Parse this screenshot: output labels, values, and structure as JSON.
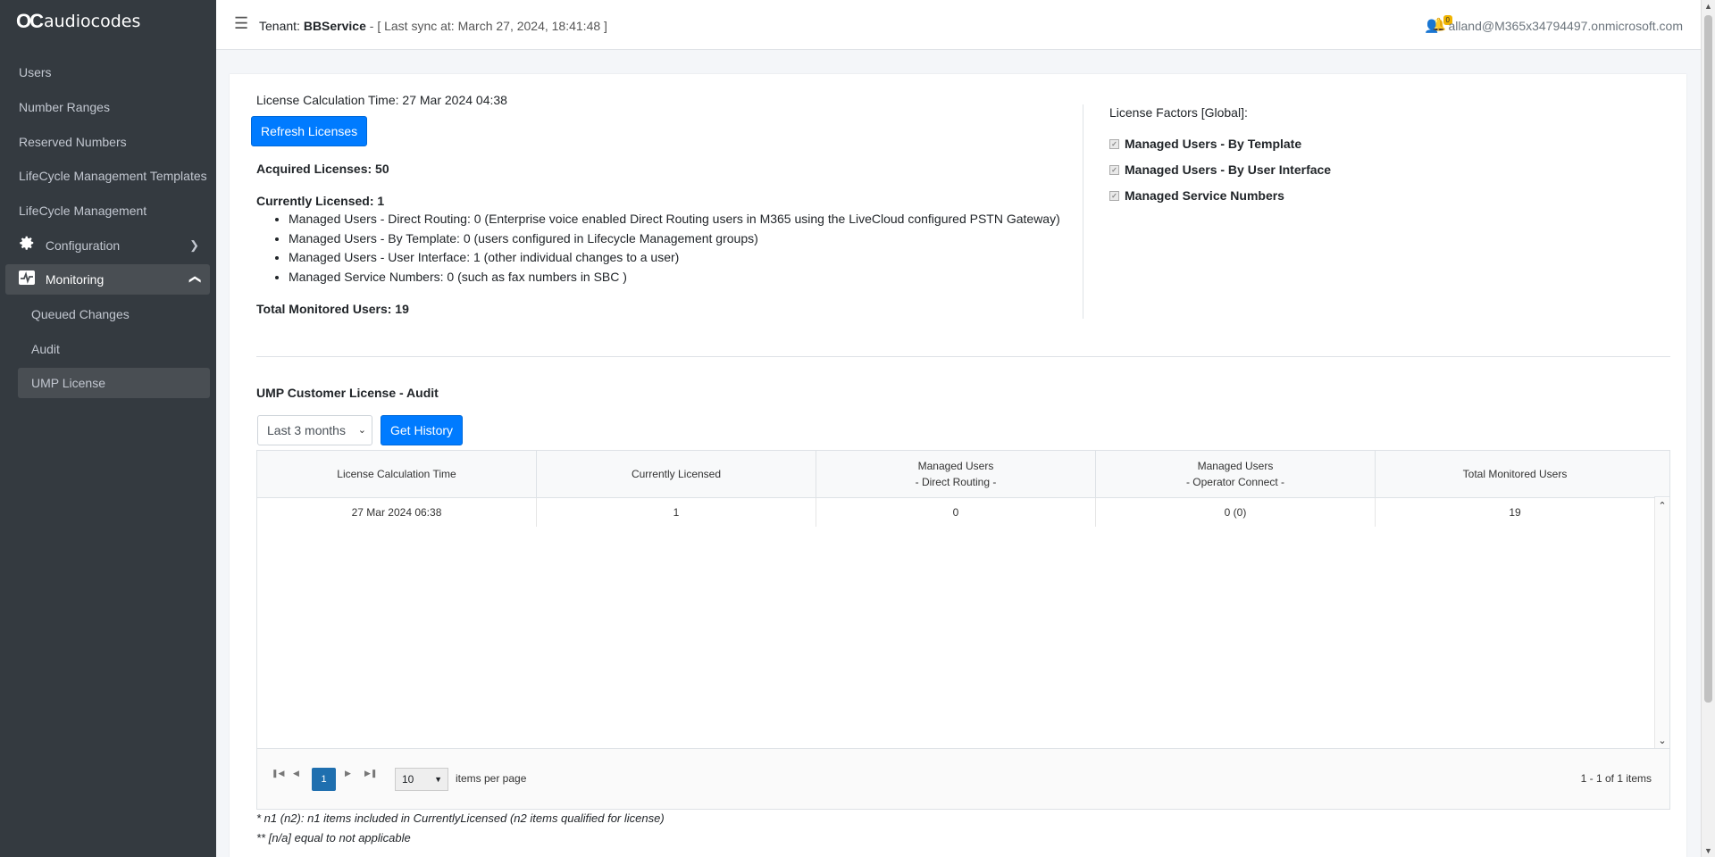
{
  "brand": {
    "mark": "OC",
    "name": "audiocodes"
  },
  "sidebar": {
    "items": [
      {
        "label": "Users"
      },
      {
        "label": "Number Ranges"
      },
      {
        "label": "Reserved Numbers"
      },
      {
        "label": "LifeCycle Management Templates"
      },
      {
        "label": "LifeCycle Management"
      },
      {
        "label": "Configuration",
        "icon": "gear-icon"
      },
      {
        "label": "Monitoring",
        "icon": "monitoring-icon"
      },
      {
        "label": "Queued Changes"
      },
      {
        "label": "Audit"
      },
      {
        "label": "UMP License"
      }
    ]
  },
  "header": {
    "tenant_prefix": "Tenant:",
    "tenant_name": "BBService",
    "sync_text": "- [ Last sync at: March 27, 2024, 18:41:48 ]",
    "notification_count": "0",
    "user": "alland@M365x34794497.onmicrosoft.com"
  },
  "license": {
    "calc_time": "License Calculation Time: 27 Mar 2024 04:38",
    "refresh_label": "Refresh Licenses",
    "acquired": "Acquired Licenses: 50",
    "currently": "Currently Licensed: 1",
    "items": [
      "Managed Users - Direct Routing: 0 (Enterprise voice enabled Direct Routing users in M365 using the LiveCloud configured PSTN Gateway)",
      "Managed Users - By Template: 0 (users configured in Lifecycle Management groups)",
      "Managed Users - User Interface: 1 (other individual changes to a user)",
      "Managed Service Numbers: 0 (such as fax numbers in SBC )"
    ],
    "total_monitored": "Total Monitored Users: 19"
  },
  "factors": {
    "title": "License Factors [Global]:",
    "items": [
      {
        "label": "Managed Users - By Template",
        "checked": true
      },
      {
        "label": "Managed Users - By User Interface",
        "checked": true
      },
      {
        "label": "Managed Service Numbers",
        "checked": true
      }
    ]
  },
  "audit": {
    "title": "UMP Customer License - Audit",
    "period_selected": "Last 3 months",
    "get_history_label": "Get History",
    "columns": [
      {
        "line1": "License Calculation Time",
        "line2": ""
      },
      {
        "line1": "Currently Licensed",
        "line2": ""
      },
      {
        "line1": "Managed Users",
        "line2": "- Direct Routing -"
      },
      {
        "line1": "Managed Users",
        "line2": "- Operator Connect -"
      },
      {
        "line1": "Total Monitored Users",
        "line2": ""
      }
    ],
    "rows": [
      [
        "27 Mar 2024 06:38",
        "1",
        "0",
        "0 (0)",
        "19"
      ]
    ],
    "pager": {
      "current_page": "1",
      "page_size": "10",
      "items_per_page_label": "items per page",
      "info": "1 - 1 of 1 items"
    }
  },
  "notes": {
    "n1": "* n1 (n2): n1 items included in CurrentlyLicensed (n2 items qualified for license)",
    "n2": "** [n/a] equal to not applicable"
  },
  "colors": {
    "sidebar_bg": "#343a40",
    "primary": "#007bff",
    "pager_active": "#1f6faf",
    "badge": "#f0b400"
  }
}
